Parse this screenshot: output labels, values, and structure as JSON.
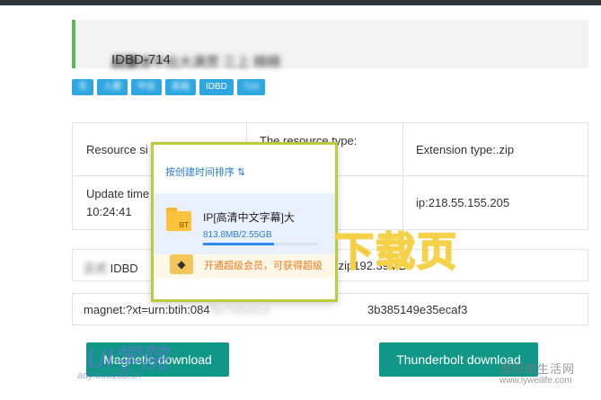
{
  "page": {
    "title_prefix": "人妻",
    "title_code": "IDBD-714",
    "title_rest": " 超快速中出大满贯 三上 精精"
  },
  "tags": [
    "无",
    "人妻",
    "中出",
    "高画",
    "IDBD",
    "714"
  ],
  "info": {
    "resource_size_label": "Resource si",
    "resource_type_label": "The resource type:",
    "extension_label": "Extension type:.zip",
    "update_time_label": "Update time",
    "update_time_value": "10:24:41",
    "ip_label": "ip:218.55.155.205"
  },
  "file_row": {
    "prefix": "正式",
    "code": " IDBD",
    "suffix": ".zip192.39MB"
  },
  "magnet_row": {
    "prefix": "magnet:?xt=urn:btih:084",
    "hidden": "f3c7a5e0c2",
    "suffix": "3b385149e35ecaf3"
  },
  "buttons": {
    "magnetic": "Magnetic download",
    "thunderbolt": "Thunderbolt download"
  },
  "popup": {
    "sort_label": "按创建时间排序 ⇅",
    "file_icon_text": "BT",
    "file_name": "IP[高清中文字幕]大",
    "file_size": "813.8MB/2.55GB",
    "progress": 0.62,
    "vip_icon": "diamond-icon",
    "vip_text": "开通超级会员，可获得超级"
  },
  "overlay": {
    "big_text": "下载页",
    "wm_left_main": "UI学院",
    "wm_left_sub": "ady.uuu188.cn",
    "wm_right_main": "溧阳微生活网",
    "wm_right_sub": "www.lyweilife.com"
  },
  "colors": {
    "accent_green": "#5cb85c",
    "tag_blue": "#2ea7e0",
    "button_teal": "#119787",
    "popup_border": "#b9cc3c",
    "overlay_red": "#e8311c"
  }
}
